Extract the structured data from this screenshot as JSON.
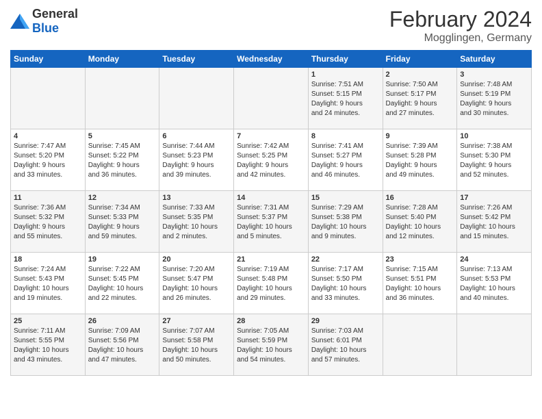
{
  "logo": {
    "general": "General",
    "blue": "Blue"
  },
  "title": {
    "month": "February 2024",
    "location": "Mogglingen, Germany"
  },
  "days_of_week": [
    "Sunday",
    "Monday",
    "Tuesday",
    "Wednesday",
    "Thursday",
    "Friday",
    "Saturday"
  ],
  "weeks": [
    [
      {
        "day": "",
        "info": ""
      },
      {
        "day": "",
        "info": ""
      },
      {
        "day": "",
        "info": ""
      },
      {
        "day": "",
        "info": ""
      },
      {
        "day": "1",
        "info": "Sunrise: 7:51 AM\nSunset: 5:15 PM\nDaylight: 9 hours\nand 24 minutes."
      },
      {
        "day": "2",
        "info": "Sunrise: 7:50 AM\nSunset: 5:17 PM\nDaylight: 9 hours\nand 27 minutes."
      },
      {
        "day": "3",
        "info": "Sunrise: 7:48 AM\nSunset: 5:19 PM\nDaylight: 9 hours\nand 30 minutes."
      }
    ],
    [
      {
        "day": "4",
        "info": "Sunrise: 7:47 AM\nSunset: 5:20 PM\nDaylight: 9 hours\nand 33 minutes."
      },
      {
        "day": "5",
        "info": "Sunrise: 7:45 AM\nSunset: 5:22 PM\nDaylight: 9 hours\nand 36 minutes."
      },
      {
        "day": "6",
        "info": "Sunrise: 7:44 AM\nSunset: 5:23 PM\nDaylight: 9 hours\nand 39 minutes."
      },
      {
        "day": "7",
        "info": "Sunrise: 7:42 AM\nSunset: 5:25 PM\nDaylight: 9 hours\nand 42 minutes."
      },
      {
        "day": "8",
        "info": "Sunrise: 7:41 AM\nSunset: 5:27 PM\nDaylight: 9 hours\nand 46 minutes."
      },
      {
        "day": "9",
        "info": "Sunrise: 7:39 AM\nSunset: 5:28 PM\nDaylight: 9 hours\nand 49 minutes."
      },
      {
        "day": "10",
        "info": "Sunrise: 7:38 AM\nSunset: 5:30 PM\nDaylight: 9 hours\nand 52 minutes."
      }
    ],
    [
      {
        "day": "11",
        "info": "Sunrise: 7:36 AM\nSunset: 5:32 PM\nDaylight: 9 hours\nand 55 minutes."
      },
      {
        "day": "12",
        "info": "Sunrise: 7:34 AM\nSunset: 5:33 PM\nDaylight: 9 hours\nand 59 minutes."
      },
      {
        "day": "13",
        "info": "Sunrise: 7:33 AM\nSunset: 5:35 PM\nDaylight: 10 hours\nand 2 minutes."
      },
      {
        "day": "14",
        "info": "Sunrise: 7:31 AM\nSunset: 5:37 PM\nDaylight: 10 hours\nand 5 minutes."
      },
      {
        "day": "15",
        "info": "Sunrise: 7:29 AM\nSunset: 5:38 PM\nDaylight: 10 hours\nand 9 minutes."
      },
      {
        "day": "16",
        "info": "Sunrise: 7:28 AM\nSunset: 5:40 PM\nDaylight: 10 hours\nand 12 minutes."
      },
      {
        "day": "17",
        "info": "Sunrise: 7:26 AM\nSunset: 5:42 PM\nDaylight: 10 hours\nand 15 minutes."
      }
    ],
    [
      {
        "day": "18",
        "info": "Sunrise: 7:24 AM\nSunset: 5:43 PM\nDaylight: 10 hours\nand 19 minutes."
      },
      {
        "day": "19",
        "info": "Sunrise: 7:22 AM\nSunset: 5:45 PM\nDaylight: 10 hours\nand 22 minutes."
      },
      {
        "day": "20",
        "info": "Sunrise: 7:20 AM\nSunset: 5:47 PM\nDaylight: 10 hours\nand 26 minutes."
      },
      {
        "day": "21",
        "info": "Sunrise: 7:19 AM\nSunset: 5:48 PM\nDaylight: 10 hours\nand 29 minutes."
      },
      {
        "day": "22",
        "info": "Sunrise: 7:17 AM\nSunset: 5:50 PM\nDaylight: 10 hours\nand 33 minutes."
      },
      {
        "day": "23",
        "info": "Sunrise: 7:15 AM\nSunset: 5:51 PM\nDaylight: 10 hours\nand 36 minutes."
      },
      {
        "day": "24",
        "info": "Sunrise: 7:13 AM\nSunset: 5:53 PM\nDaylight: 10 hours\nand 40 minutes."
      }
    ],
    [
      {
        "day": "25",
        "info": "Sunrise: 7:11 AM\nSunset: 5:55 PM\nDaylight: 10 hours\nand 43 minutes."
      },
      {
        "day": "26",
        "info": "Sunrise: 7:09 AM\nSunset: 5:56 PM\nDaylight: 10 hours\nand 47 minutes."
      },
      {
        "day": "27",
        "info": "Sunrise: 7:07 AM\nSunset: 5:58 PM\nDaylight: 10 hours\nand 50 minutes."
      },
      {
        "day": "28",
        "info": "Sunrise: 7:05 AM\nSunset: 5:59 PM\nDaylight: 10 hours\nand 54 minutes."
      },
      {
        "day": "29",
        "info": "Sunrise: 7:03 AM\nSunset: 6:01 PM\nDaylight: 10 hours\nand 57 minutes."
      },
      {
        "day": "",
        "info": ""
      },
      {
        "day": "",
        "info": ""
      }
    ]
  ]
}
